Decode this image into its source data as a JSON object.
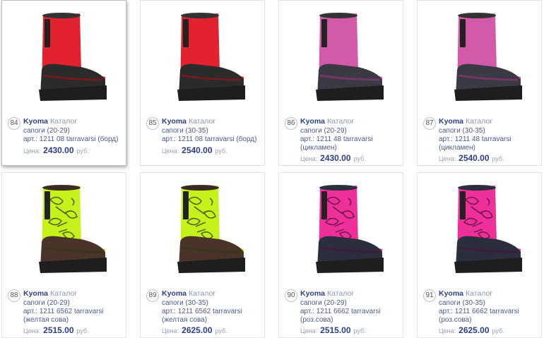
{
  "products": [
    {
      "num": "84",
      "brand": "Kyoma",
      "catalog": "Каталог",
      "type": "сапоги (20-29)",
      "article": "арт.: 1211 08 tarravarsi (борд)",
      "price_label": "Цена:",
      "price": "2430.00",
      "currency": "руб.",
      "color": "red"
    },
    {
      "num": "85",
      "brand": "Kyoma",
      "catalog": "Каталог",
      "type": "сапоги (30-35)",
      "article": "арт.: 1211 08 tarravarsi (борд)",
      "price_label": "Цена:",
      "price": "2540.00",
      "currency": "руб.",
      "color": "red"
    },
    {
      "num": "86",
      "brand": "Kyoma",
      "catalog": "Каталог",
      "type": "сапоги (20-29)",
      "article": "арт.: 1211 48 tarravarsi (цикламен)",
      "price_label": "Цена:",
      "price": "2430.00",
      "currency": "руб.",
      "color": "pink"
    },
    {
      "num": "87",
      "brand": "Kyoma",
      "catalog": "Каталог",
      "type": "сапоги (30-35)",
      "article": "арт.: 1211 48 tarravarsi (цикламен)",
      "price_label": "Цена:",
      "price": "2540.00",
      "currency": "руб.",
      "color": "pink"
    },
    {
      "num": "88",
      "brand": "Kyoma",
      "catalog": "Каталог",
      "type": "сапоги (20-29)",
      "article": "арт.: 1211 6562 tarravarsi (желтая сова)",
      "price_label": "Цена:",
      "price": "2515.00",
      "currency": "руб.",
      "color": "lime"
    },
    {
      "num": "89",
      "brand": "Kyoma",
      "catalog": "Каталог",
      "type": "сапоги (30-35)",
      "article": "арт.: 1211 6562 tarravarsi (желтая сова)",
      "price_label": "Цена:",
      "price": "2625.00",
      "currency": "руб.",
      "color": "lime"
    },
    {
      "num": "90",
      "brand": "Kyoma",
      "catalog": "Каталог",
      "type": "сапоги (20-29)",
      "article": "арт.: 1211 6662 tarravarsi (роз.сова)",
      "price_label": "Цена:",
      "price": "2515.00",
      "currency": "руб.",
      "color": "magenta"
    },
    {
      "num": "91",
      "brand": "Kyoma",
      "catalog": "Каталог",
      "type": "сапоги (30-35)",
      "article": "арт.: 1211 6662 tarravarsi (роз.сова)",
      "price_label": "Цена:",
      "price": "2625.00",
      "currency": "руб.",
      "color": "magenta"
    }
  ],
  "boot_colors": {
    "red": {
      "shaft": "#e0232e",
      "dark": "#9e1119",
      "sole": "#2b2b2b",
      "trim": "#333"
    },
    "pink": {
      "shaft": "#d35aa8",
      "dark": "#9a3378",
      "sole": "#3a3a44",
      "trim": "#333"
    },
    "lime": {
      "shaft": "#c6f21c",
      "dark": "#2e3b12",
      "sole": "#4a3328",
      "trim": "#3a2a22",
      "pattern": true
    },
    "magenta": {
      "shaft": "#ef2f9a",
      "dark": "#4a1234",
      "sole": "#2b2f3d",
      "trim": "#2b2f3d",
      "pattern": true
    }
  }
}
